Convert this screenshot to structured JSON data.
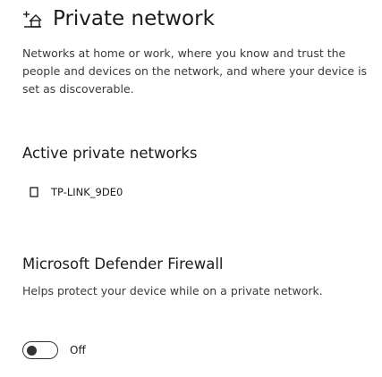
{
  "header": {
    "title": "Private network",
    "icon": "house-network-icon"
  },
  "description": "Networks at home or work, where you know and trust the people and devices on the network, and where your device is set as discoverable.",
  "active_networks": {
    "heading": "Active private networks",
    "items": [
      {
        "name": "TP-LINK_9DE0",
        "icon": "network-adapter-icon"
      }
    ]
  },
  "firewall": {
    "heading": "Microsoft Defender Firewall",
    "description": "Helps protect your device while on a private network.",
    "toggle": {
      "state": "Off",
      "is_on": false
    }
  }
}
